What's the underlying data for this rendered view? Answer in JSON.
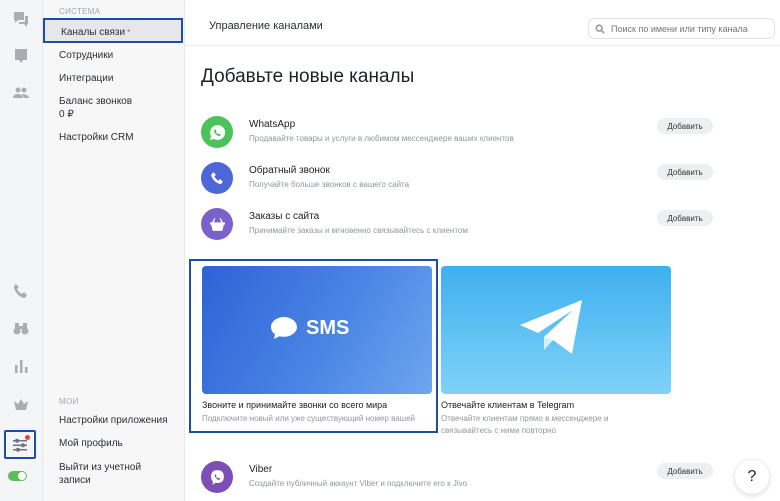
{
  "sidebar": {
    "section_system": "СИСТЕМА",
    "items_top": [
      "Каналы связи",
      "Сотрудники",
      "Интеграции",
      "Баланс звонков",
      "0 ₽",
      "Настройки CRM"
    ],
    "active_mark": "*",
    "section_my": "МОИ",
    "items_bottom": [
      "Настройки приложения",
      "Мой профиль",
      "Выйти из учетной",
      "записи"
    ]
  },
  "header": {
    "title": "Управление каналами",
    "search_placeholder": "Поиск по имени или типу канала"
  },
  "main": {
    "heading": "Добавьте новые каналы",
    "add_label": "Добавить",
    "channels": [
      {
        "name": "WhatsApp",
        "desc": "Продавайте товары и услуги в любимом мессенджере ваших клиентов",
        "color": "#4cc35a",
        "icon": "whatsapp-icon"
      },
      {
        "name": "Обратный звонок",
        "desc": "Получайте больше звонков с вашего сайта",
        "color": "#4e67d8",
        "icon": "phone-icon"
      },
      {
        "name": "Заказы с сайта",
        "desc": "Принимайте заказы и мгновенно связывайтесь с клиентом",
        "color": "#7b61c9",
        "icon": "basket-icon"
      },
      {
        "name": "Viber",
        "desc": "Создайте публичный аккаунт Viber и подключите его к Jivo",
        "color": "#7d4fb6",
        "icon": "viber-icon"
      }
    ],
    "cards": [
      {
        "logo_text": "SMS",
        "title": "Звоните и принимайте звонки со всего мира",
        "desc": "Подключите новый или уже существующий номер вашей"
      },
      {
        "title": "Отвечайте клиентам в Telegram",
        "desc": "Отвечайте клиентам прямо в мессенджере и связывайтесь с ними повторно"
      }
    ]
  },
  "help_label": "?"
}
